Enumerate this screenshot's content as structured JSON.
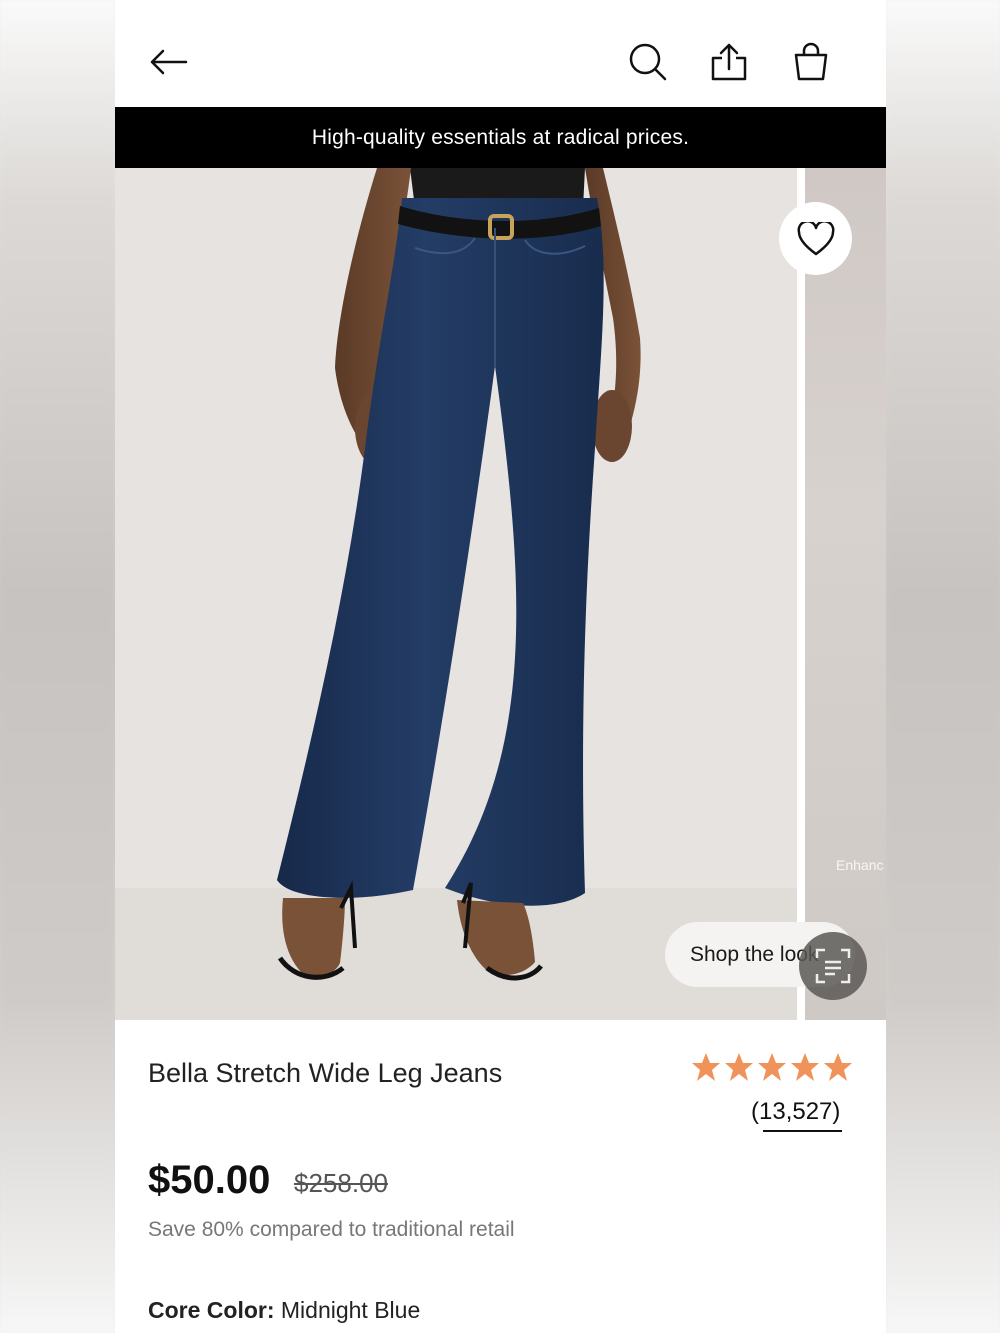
{
  "header": {
    "back_icon": "arrow-left-icon",
    "search_icon": "search-icon",
    "share_icon": "share-icon",
    "bag_icon": "shopping-bag-icon"
  },
  "promo_banner": {
    "text": "High-quality essentials at radical prices."
  },
  "hero": {
    "favorite_icon": "heart-icon",
    "next_image_caption": "Enhanc",
    "shop_the_look_label": "Shop the look",
    "shop_the_look_icon": "visual-search-icon"
  },
  "product": {
    "title": "Bella Stretch Wide Leg Jeans",
    "rating": 5,
    "rating_max": 5,
    "star_color": "#f0935a",
    "review_count": "(13,527)",
    "price": "$50.00",
    "original_price": "$258.00",
    "savings_text": "Save 80% compared to traditional retail",
    "core_color_label": "Core Color:",
    "core_color_value": "Midnight Blue"
  },
  "colors": {
    "denim": "#1f3558",
    "background": "#e8e4e1",
    "banner": "#000000"
  }
}
